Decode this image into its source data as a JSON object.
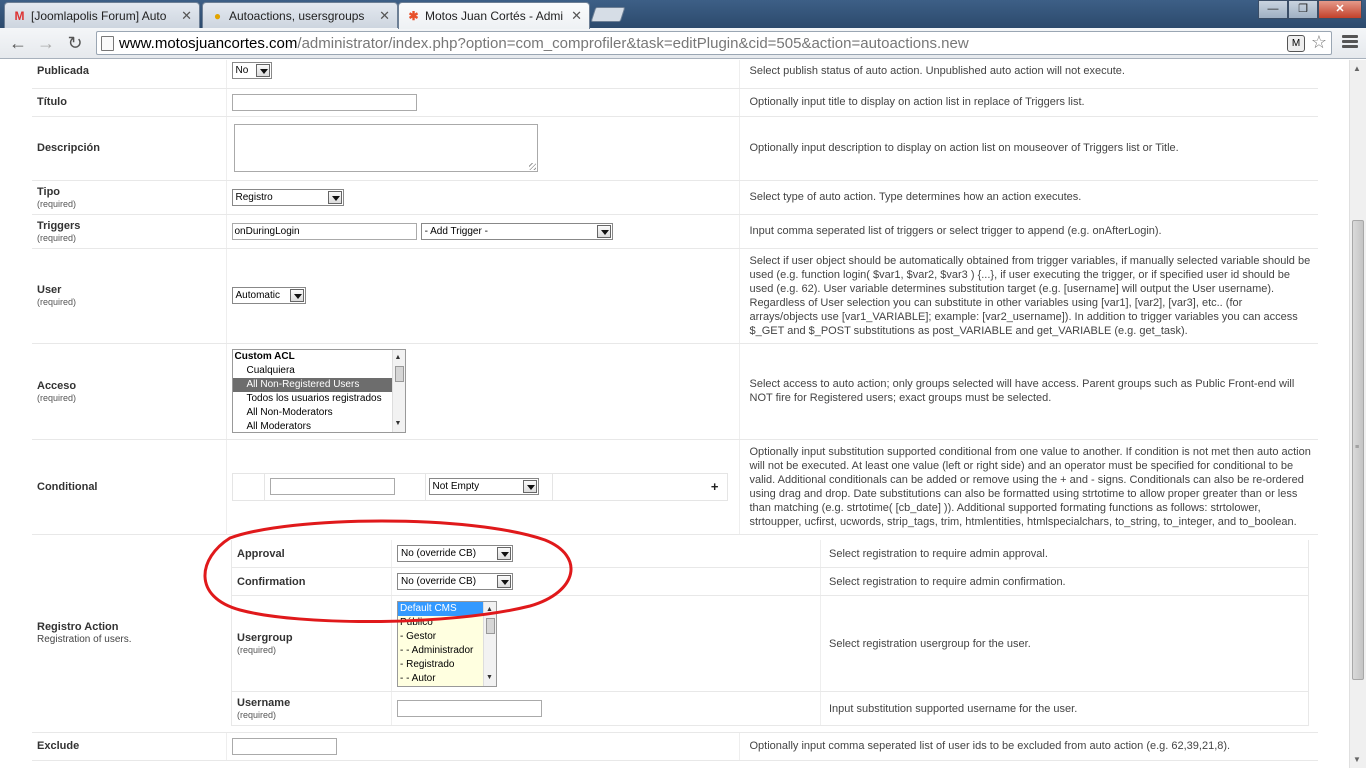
{
  "browser": {
    "tabs": [
      {
        "title": "[Joomlapolis Forum] Auto",
        "icon": "gmail-icon"
      },
      {
        "title": "Autoactions, usersgroups",
        "icon": "forum-icon"
      },
      {
        "title": "Motos Juan Cortés - Admi",
        "icon": "joomla-icon"
      }
    ],
    "url_host": "www.motosjuancortes.com",
    "url_path": "/administrator/index.php?option=com_comprofiler&task=editPlugin&cid=505&action=autoactions.new",
    "ext_label": "M"
  },
  "rows": {
    "publicada": {
      "label": "Publicada",
      "value": "No",
      "desc": "Select publish status of auto action. Unpublished auto action will not execute."
    },
    "titulo": {
      "label": "Título",
      "value": "",
      "desc": "Optionally input title to display on action list in replace of Triggers list."
    },
    "descripcion": {
      "label": "Descripción",
      "value": "",
      "desc": "Optionally input description to display on action list on mouseover of Triggers list or Title."
    },
    "tipo": {
      "label": "Tipo",
      "required": "(required)",
      "value": "Registro",
      "desc": "Select type of auto action. Type determines how an action executes."
    },
    "triggers": {
      "label": "Triggers",
      "required": "(required)",
      "value": "onDuringLogin",
      "add_trigger": "- Add Trigger -",
      "desc": "Input comma seperated list of triggers or select trigger to append (e.g. onAfterLogin)."
    },
    "user": {
      "label": "User",
      "required": "(required)",
      "value": "Automatic",
      "desc": "Select if user object should be automatically obtained from trigger variables, if manually selected variable should be used (e.g. function login( $var1, $var2, $var3 ) {...}, if user executing the trigger, or if specified user id should be used (e.g. 62). User variable determines substitution target (e.g. [username] will output the User username). Regardless of User selection you can substitute in other variables using [var1], [var2], [var3], etc.. (for arrays/objects use [var1_VARIABLE]; example: [var2_username]). In addition to trigger variables you can access $_GET and $_POST substitutions as post_VARIABLE and get_VARIABLE (e.g. get_task)."
    },
    "acceso": {
      "label": "Acceso",
      "required": "(required)",
      "options": [
        "Custom ACL",
        "Cualquiera",
        "All Non-Registered Users",
        "Todos los usuarios registrados",
        "All Non-Moderators",
        "All Moderators"
      ],
      "selected": "All Non-Registered Users",
      "desc": "Select access to auto action; only groups selected will have access. Parent groups such as Public Front-end will NOT fire for Registered users; exact groups must be selected."
    },
    "conditional": {
      "label": "Conditional",
      "operator": "Not Empty",
      "add": "+",
      "desc": "Optionally input substitution supported conditional from one value to another. If condition is not met then auto action will not be executed. At least one value (left or right side) and an operator must be specified for conditional to be valid. Additional conditionals can be added or remove using the + and - signs. Conditionals can also be re-ordered using drag and drop. Date substitutions can also be formatted using strtotime to allow proper greater than or less than matching (e.g. strtotime( [cb_date] )). Additional supported formating functions as follows: strtolower, strtoupper, ucfirst, ucwords, strip_tags, trim, htmlentities, htmlspecialchars, to_string, to_integer, and to_boolean."
    },
    "registro": {
      "label": "Registro Action",
      "sublabel": "Registration of users.",
      "approval": {
        "label": "Approval",
        "value": "No (override CB)",
        "desc": "Select registration to require admin approval."
      },
      "confirmation": {
        "label": "Confirmation",
        "value": "No (override CB)",
        "desc": "Select registration to require admin confirmation."
      },
      "usergroup": {
        "label": "Usergroup",
        "required": "(required)",
        "options": [
          "Default CMS",
          "Público",
          "- Gestor",
          "- - Administrador",
          "- Registrado",
          "- - Autor"
        ],
        "selected": "Default CMS",
        "desc": "Select registration usergroup for the user."
      },
      "username": {
        "label": "Username",
        "required": "(required)",
        "value": "",
        "desc": "Input substitution supported username for the user."
      }
    },
    "exclude": {
      "label": "Exclude",
      "value": "",
      "desc": "Optionally input comma seperated list of user ids to be excluded from auto action (e.g. 62,39,21,8)."
    }
  },
  "colors": {
    "annotation": "#e0191b",
    "listbox_gray": "#6d6d6d",
    "listbox_blue": "#3399ff",
    "usergroup_bg": "#ffffe0"
  }
}
